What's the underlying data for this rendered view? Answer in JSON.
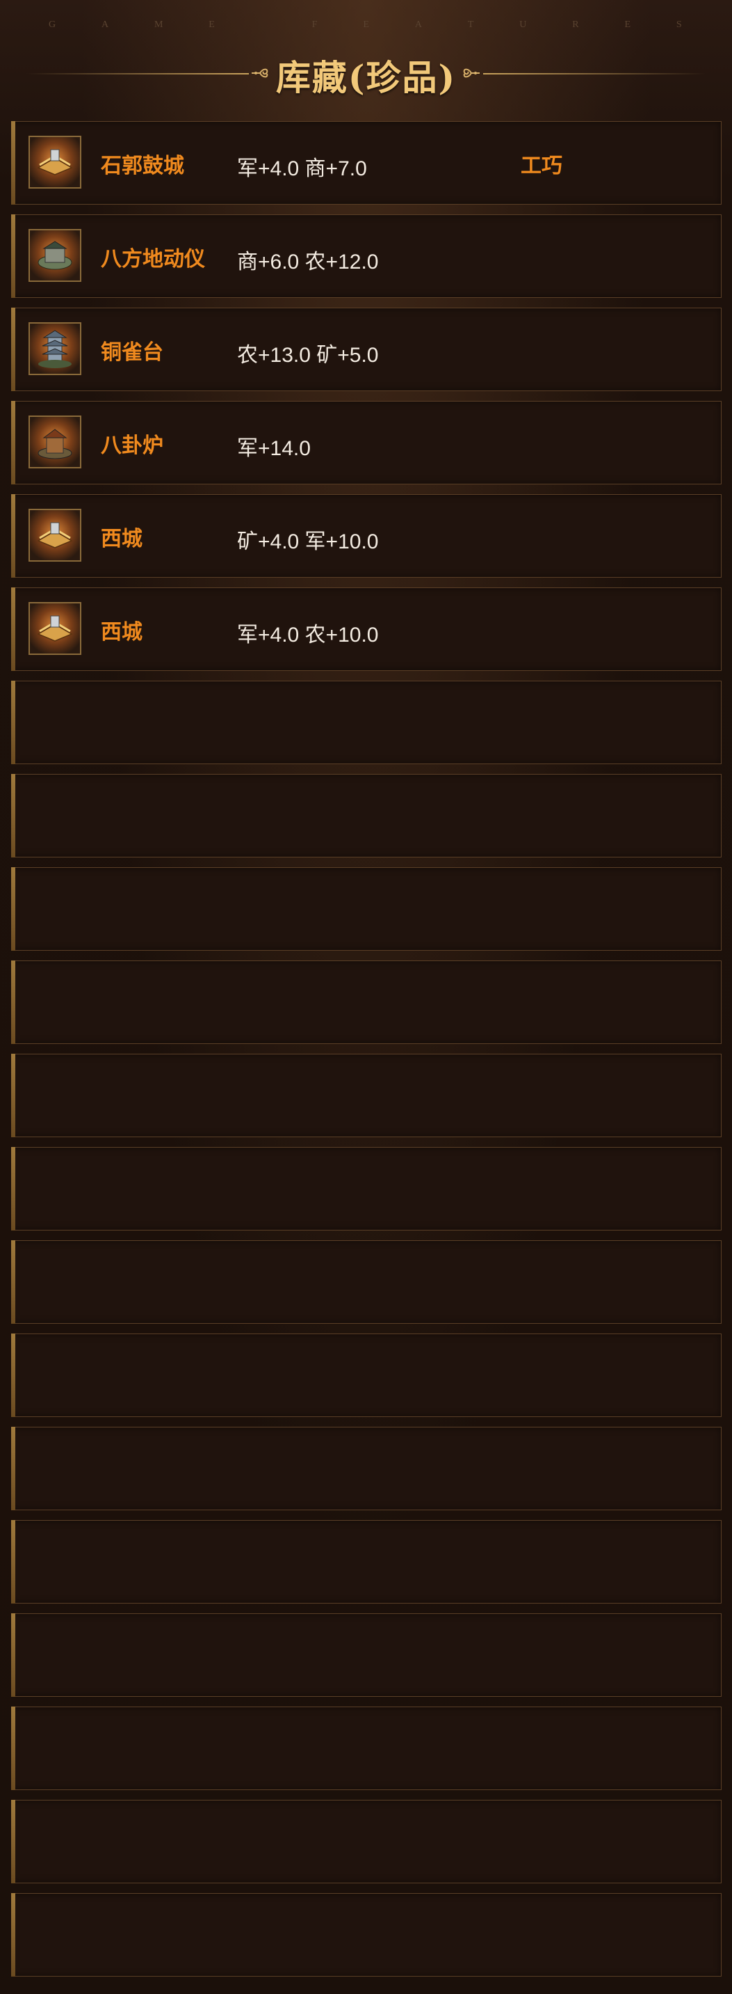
{
  "header": {
    "watermark": [
      "G",
      "A",
      "M",
      "E",
      "",
      "F",
      "E",
      "A",
      "T",
      "U",
      "R",
      "E",
      "S"
    ],
    "title": "库藏(珍品)"
  },
  "items": [
    {
      "name": "石郭鼓城",
      "stats": "军+4.0 商+7.0",
      "tag": "工巧",
      "icon": "scroll-icon"
    },
    {
      "name": "八方地动仪",
      "stats": "商+6.0 农+12.0",
      "tag": "",
      "icon": "seismograph-icon"
    },
    {
      "name": "铜雀台",
      "stats": "农+13.0 矿+5.0",
      "tag": "",
      "icon": "tower-icon"
    },
    {
      "name": "八卦炉",
      "stats": "军+14.0",
      "tag": "",
      "icon": "furnace-icon"
    },
    {
      "name": "西城",
      "stats": "矿+4.0 军+10.0",
      "tag": "",
      "icon": "scroll-icon"
    },
    {
      "name": "西城",
      "stats": "军+4.0 农+10.0",
      "tag": "",
      "icon": "scroll-icon"
    }
  ],
  "empty_slots": 14
}
